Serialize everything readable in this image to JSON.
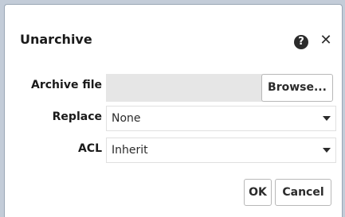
{
  "dialog": {
    "title": "Unarchive",
    "help_icon_glyph": "?",
    "close_icon_glyph": "✕"
  },
  "form": {
    "archive_file_label": "Archive file",
    "archive_file_value": "",
    "browse_label": "Browse...",
    "replace_label": "Replace",
    "replace_value": "None",
    "acl_label": "ACL",
    "acl_value": "Inherit"
  },
  "footer": {
    "ok_label": "OK",
    "cancel_label": "Cancel"
  },
  "icons": {
    "help": "help-icon",
    "close": "close-icon",
    "dropdown": "chevron-down-icon"
  }
}
